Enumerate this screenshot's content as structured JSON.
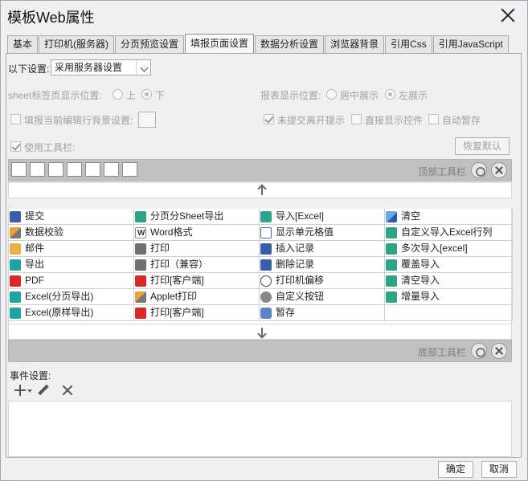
{
  "window": {
    "title": "模板Web属性"
  },
  "tabs": [
    {
      "label": "基本"
    },
    {
      "label": "打印机(服务器)"
    },
    {
      "label": "分页预览设置"
    },
    {
      "label": "填报页面设置"
    },
    {
      "label": "数据分析设置"
    },
    {
      "label": "浏览器背景"
    },
    {
      "label": "引用Css"
    },
    {
      "label": "引用JavaScript"
    }
  ],
  "settings": {
    "mode_label": "以下设置:",
    "mode_value": "采用服务器设置",
    "sheet_label": "sheet标签页显示位置:",
    "sheet_up": "上",
    "sheet_down": "下",
    "report_label": "报表显示位置:",
    "report_center": "居中展示",
    "report_left": "左展示",
    "bg_label": "填报当前编辑行背景设置:",
    "unsubmit_label": "未提交离开提示",
    "direct_label": "直接显示控件",
    "autosave_label": "自动暂存",
    "use_toolbar_label": "使用工具栏:",
    "restore_label": "恢复默认"
  },
  "top_toolbar": {
    "label": "顶部工具栏"
  },
  "bottom_toolbar": {
    "label": "底部工具栏"
  },
  "grid": [
    [
      {
        "t": "提交",
        "i": "blue"
      },
      {
        "t": "分页分Sheet导出",
        "i": "green"
      },
      {
        "t": "导入[Excel]",
        "i": "green"
      },
      {
        "t": "清空",
        "i": "eraser"
      }
    ],
    [
      {
        "t": "数据校验",
        "i": "pencil"
      },
      {
        "t": "Word格式",
        "i": "word"
      },
      {
        "t": "显示单元格值",
        "i": "cellbox"
      },
      {
        "t": "自定义导入Excel行列",
        "i": "green"
      }
    ],
    [
      {
        "t": "邮件",
        "i": "mail"
      },
      {
        "t": "打印",
        "i": "gray"
      },
      {
        "t": "插入记录",
        "i": "blue"
      },
      {
        "t": "多次导入[excel]",
        "i": "green"
      }
    ],
    [
      {
        "t": "导出",
        "i": "teal"
      },
      {
        "t": "打印（兼容）",
        "i": "gray"
      },
      {
        "t": "删除记录",
        "i": "blue"
      },
      {
        "t": "覆盖导入",
        "i": "green"
      }
    ],
    [
      {
        "t": "PDF",
        "i": "red"
      },
      {
        "t": "打印[客户端]",
        "i": "red"
      },
      {
        "t": "打印机偏移",
        "i": "arrows"
      },
      {
        "t": "清空导入",
        "i": "green"
      }
    ],
    [
      {
        "t": "Excel(分页导出)",
        "i": "teal"
      },
      {
        "t": "Applet打印",
        "i": "pencil"
      },
      {
        "t": "自定义按钮",
        "i": "gear"
      },
      {
        "t": "增量导入",
        "i": "green"
      }
    ],
    [
      {
        "t": "Excel(原样导出)",
        "i": "teal"
      },
      {
        "t": "打印[客户端]",
        "i": "red"
      },
      {
        "t": "暂存",
        "i": "clock"
      },
      {
        "t": "",
        "i": ""
      }
    ]
  ],
  "events": {
    "label": "事件设置:"
  },
  "footer": {
    "ok": "确定",
    "cancel": "取消"
  }
}
